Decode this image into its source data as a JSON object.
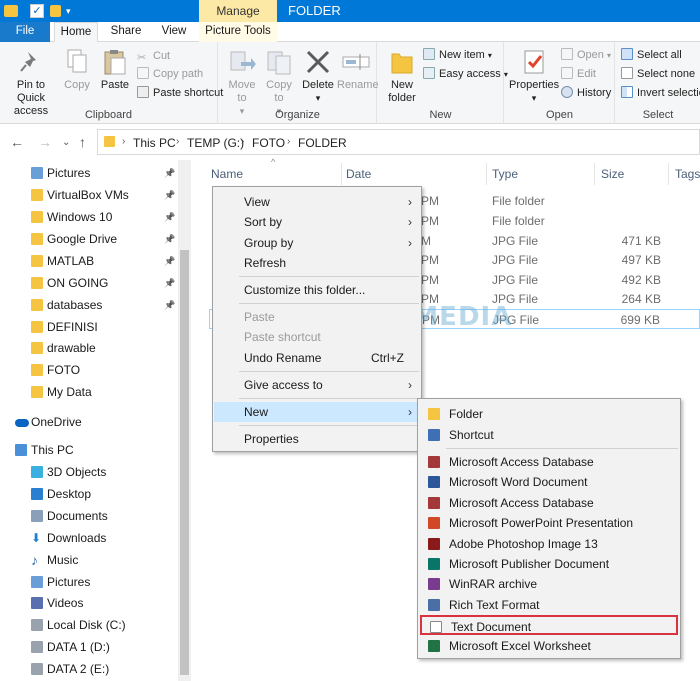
{
  "titlebar": {
    "manage_label": "Manage",
    "title": "FOLDER",
    "accent": "#0078d7"
  },
  "tabs": {
    "file": "File",
    "home": "Home",
    "share": "Share",
    "view": "View",
    "picture_tools": "Picture Tools"
  },
  "ribbon": {
    "clipboard": {
      "label": "Clipboard",
      "pin": "Pin to Quick access",
      "copy": "Copy",
      "paste": "Paste",
      "cut": "Cut",
      "copy_path": "Copy path",
      "paste_shortcut": "Paste shortcut"
    },
    "organize": {
      "label": "Organize",
      "move_to": "Move to",
      "copy_to": "Copy to",
      "delete": "Delete",
      "rename": "Rename"
    },
    "new": {
      "label": "New",
      "new_folder": "New folder",
      "new_item": "New item",
      "easy_access": "Easy access"
    },
    "open": {
      "label": "Open",
      "properties": "Properties",
      "open": "Open",
      "edit": "Edit",
      "history": "History"
    },
    "select": {
      "label": "Select",
      "select_all": "Select all",
      "select_none": "Select none",
      "invert": "Invert selection"
    }
  },
  "address": {
    "crumbs": [
      "This PC",
      "TEMP (G:)",
      "FOTO",
      "FOLDER"
    ]
  },
  "nav": {
    "quick": [
      {
        "label": "Pictures",
        "pinned": true
      },
      {
        "label": "VirtualBox VMs",
        "pinned": true
      },
      {
        "label": "Windows 10",
        "pinned": true
      },
      {
        "label": "Google Drive",
        "pinned": true
      },
      {
        "label": "MATLAB",
        "pinned": true
      },
      {
        "label": "ON GOING",
        "pinned": true
      },
      {
        "label": "databases",
        "pinned": true
      },
      {
        "label": "DEFINISI",
        "pinned": false
      },
      {
        "label": "drawable",
        "pinned": false
      },
      {
        "label": "FOTO",
        "pinned": false
      },
      {
        "label": "My Data",
        "pinned": false
      }
    ],
    "onedrive": "OneDrive",
    "thispc": "This PC",
    "pc_items": [
      "3D Objects",
      "Desktop",
      "Documents",
      "Downloads",
      "Music",
      "Pictures",
      "Videos",
      "Local Disk (C:)",
      "DATA 1 (D:)",
      "DATA 2 (E:)"
    ]
  },
  "columns": {
    "name": "Name",
    "date": "Date",
    "type": "Type",
    "size": "Size",
    "tags": "Tags"
  },
  "files": [
    {
      "date": "PM",
      "type": "File folder",
      "size": ""
    },
    {
      "date": "PM",
      "type": "File folder",
      "size": ""
    },
    {
      "date": "M",
      "type": "JPG File",
      "size": "471 KB"
    },
    {
      "date": "PM",
      "type": "JPG File",
      "size": "497 KB"
    },
    {
      "date": "PM",
      "type": "JPG File",
      "size": "492 KB"
    },
    {
      "date": "PM",
      "type": "JPG File",
      "size": "264 KB"
    },
    {
      "date": "PM",
      "type": "JPG File",
      "size": "699 KB"
    }
  ],
  "watermark": "NESABAMEDIA",
  "context_menu": {
    "view": "View",
    "sort_by": "Sort by",
    "group_by": "Group by",
    "refresh": "Refresh",
    "customize": "Customize this folder...",
    "paste": "Paste",
    "paste_shortcut": "Paste shortcut",
    "undo_rename": "Undo Rename",
    "undo_shortcut": "Ctrl+Z",
    "give_access": "Give access to",
    "new": "New",
    "properties": "Properties"
  },
  "submenu": {
    "items": [
      "Folder",
      "Shortcut",
      "Microsoft Access Database",
      "Microsoft Word Document",
      "Microsoft Access Database",
      "Microsoft PowerPoint Presentation",
      "Adobe Photoshop Image 13",
      "Microsoft Publisher Document",
      "WinRAR archive",
      "Rich Text Format",
      "Text Document",
      "Microsoft Excel Worksheet"
    ],
    "highlight_color": "#d9333f"
  }
}
